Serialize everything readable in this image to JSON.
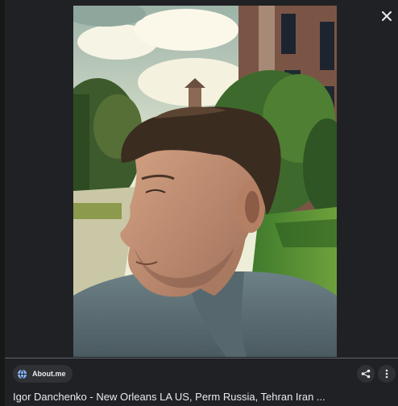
{
  "viewer": {
    "close_icon": "close-icon",
    "image_alt": "Igor Danchenko - New Orleans LA US, Perm Russia, Tehran Iran ...",
    "source": {
      "icon": "globe-icon",
      "label": "About.me"
    },
    "actions": {
      "share_icon": "share-icon",
      "more_icon": "more-vert-icon"
    },
    "title": "Igor Danchenko - New Orleans LA US, Perm Russia, Tehran Iran ..."
  },
  "colors": {
    "background": "#202124",
    "chip": "#303134",
    "text": "#e8eaed",
    "divider": "#5f6368"
  }
}
